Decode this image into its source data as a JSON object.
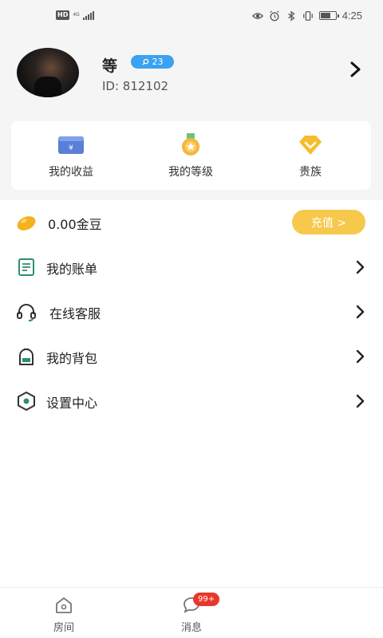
{
  "status_bar": {
    "hd_label": "HD",
    "network_label": "4G",
    "time": "4:25"
  },
  "profile": {
    "nickname": "等",
    "level": "23",
    "user_id": "ID: 812102"
  },
  "quick_actions": [
    {
      "label": "我的收益",
      "icon": "wallet-icon",
      "color": "#5a7fd6"
    },
    {
      "label": "我的等级",
      "icon": "medal-icon",
      "color": "#f3b73a"
    },
    {
      "label": "贵族",
      "icon": "diamond-icon",
      "color": "#f5bd2e"
    }
  ],
  "balance": {
    "amount": "0.00金豆",
    "recharge_label": "充值 >"
  },
  "menu": [
    {
      "label": "我的账单",
      "icon": "bill-icon"
    },
    {
      "label": "在线客服",
      "icon": "headset-icon"
    },
    {
      "label": "我的背包",
      "icon": "backpack-icon"
    },
    {
      "label": "设置中心",
      "icon": "settings-icon"
    }
  ],
  "tabbar": {
    "tabs": [
      {
        "label": "房间",
        "icon": "home-icon"
      },
      {
        "label": "消息",
        "icon": "chat-icon",
        "badge": "99+"
      }
    ]
  },
  "colors": {
    "accent_blue": "#3aa2f0",
    "recharge_yellow": "#f6c84c",
    "badge_red": "#e8372d",
    "menu_green": "#2f8f6a"
  }
}
